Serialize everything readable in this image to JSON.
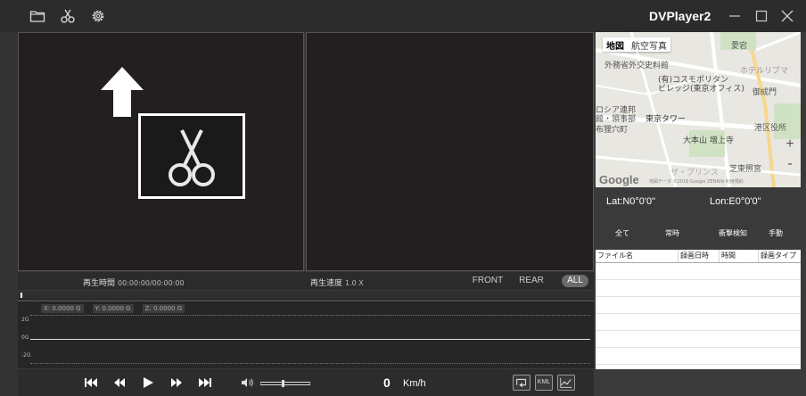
{
  "app": {
    "title": "DVPlayer2"
  },
  "toolbar": {
    "icons": [
      "folder-icon",
      "scissors-icon",
      "gear-icon"
    ]
  },
  "window_controls": [
    "minimize-icon",
    "maximize-icon",
    "close-icon"
  ],
  "status": {
    "play_time_label": "再生時間",
    "play_time_value": "00:00:00/00:00:00",
    "play_speed_label": "再生速度",
    "play_speed_value": "1.0 X",
    "cameras": [
      "FRONT",
      "REAR",
      "ALL"
    ],
    "selected_camera": "ALL"
  },
  "progress": {
    "position": 0.0
  },
  "gsensor": {
    "legend": [
      "X: 0.0000 G",
      "Y: 0.0000 G",
      "Z: 0.0000 G"
    ],
    "ticks": [
      "2G",
      "0G",
      "-2G"
    ]
  },
  "controls": {
    "speed_value": "0",
    "speed_unit": "Km/h",
    "kml_label": "KML",
    "icons": [
      "skip-to-start-icon",
      "rewind-icon",
      "play-icon",
      "fast-forward-icon",
      "skip-to-end-icon",
      "volume-icon",
      "volume-slider",
      "rotate-icon",
      "kml-button",
      "graph-icon"
    ]
  },
  "map": {
    "tabs": [
      "地図",
      "航空写真"
    ],
    "active_tab": "地図",
    "labels": [
      "外務省外交史料館",
      "(有)コスモポリタン",
      "ビレッジ(東京オフィス)",
      "ホテルリブマ",
      "御成門",
      "ロシア連邦",
      "館・領事部",
      "東京タワー",
      "港区役所",
      "布狸穴町",
      "大本山 増上寺",
      "芝東照宮",
      "ザ・プリンス",
      "愛宕"
    ],
    "logo": "Google",
    "attribution": "地図データ ©2018 Google ZENRIN  利用規約"
  },
  "coords": {
    "lat": "Lat:N0°0'0\"",
    "lon": "Lon:E0°0'0\""
  },
  "filters": [
    "全て",
    "常時",
    "衝撃検知",
    "手動"
  ],
  "file_table": {
    "columns": [
      "ファイル名",
      "録画日時",
      "時間",
      "録画タイプ"
    ],
    "rows": []
  },
  "colors": {
    "background": "#3a3a3a",
    "titlebar": "#2c2c2c",
    "video": "#231f20",
    "accent_white": "#ffffff"
  }
}
